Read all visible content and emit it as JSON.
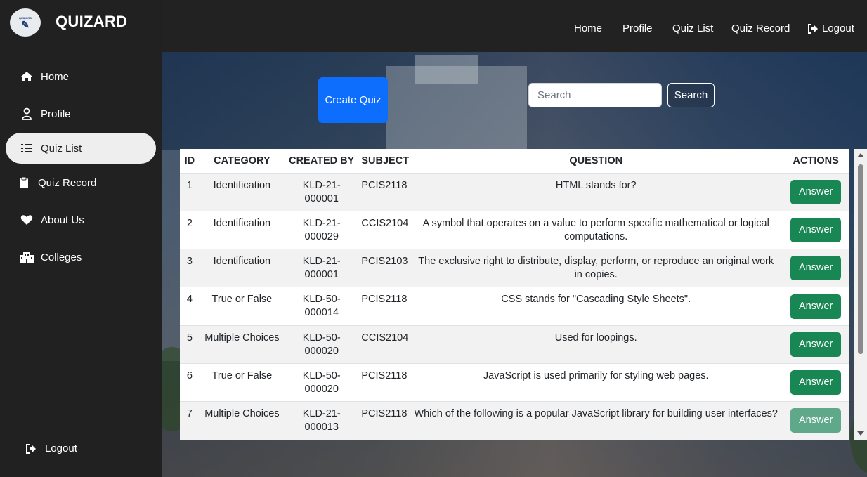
{
  "brand": {
    "name": "QUIZARD",
    "logo_text": "QUIZARD"
  },
  "sidebar": {
    "items": [
      {
        "label": "Home",
        "icon": "home-icon"
      },
      {
        "label": "Profile",
        "icon": "user-icon"
      },
      {
        "label": "Quiz List",
        "icon": "list-icon",
        "active": true
      },
      {
        "label": "Quiz Record",
        "icon": "clipboard-icon"
      },
      {
        "label": "About Us",
        "icon": "heart-icon"
      },
      {
        "label": "Colleges",
        "icon": "building-icon"
      }
    ],
    "logout_label": "Logout"
  },
  "topnav": {
    "links": [
      "Home",
      "Profile",
      "Quiz List",
      "Quiz Record"
    ],
    "logout_label": "Logout"
  },
  "toolbar": {
    "create_label": "Create Quiz",
    "search_placeholder": "Search",
    "search_button": "Search"
  },
  "table": {
    "headers": [
      "ID",
      "CATEGORY",
      "CREATED BY",
      "SUBJECT",
      "QUESTION",
      "ACTIONS"
    ],
    "action_label": "Answer",
    "rows": [
      {
        "id": "1",
        "category": "Identification",
        "created_by": "KLD-21-000001",
        "subject": "PCIS2118",
        "question": "HTML stands for?"
      },
      {
        "id": "2",
        "category": "Identification",
        "created_by": "KLD-21-000029",
        "subject": "CCIS2104",
        "question": "A symbol that operates on a value to perform specific mathematical or logical computations."
      },
      {
        "id": "3",
        "category": "Identification",
        "created_by": "KLD-21-000001",
        "subject": "PCIS2103",
        "question": "The exclusive right to distribute, display, perform, or reproduce an original work in copies."
      },
      {
        "id": "4",
        "category": "True or False",
        "created_by": "KLD-50-000014",
        "subject": "PCIS2118",
        "question": "CSS stands for \"Cascading Style Sheets\"."
      },
      {
        "id": "5",
        "category": "Multiple Choices",
        "created_by": "KLD-50-000020",
        "subject": "CCIS2104",
        "question": "Used for loopings."
      },
      {
        "id": "6",
        "category": "True or False",
        "created_by": "KLD-50-000020",
        "subject": "PCIS2118",
        "question": "JavaScript is used primarily for styling web pages."
      },
      {
        "id": "7",
        "category": "Multiple Choices",
        "created_by": "KLD-21-000013",
        "subject": "PCIS2118",
        "question": "Which of the following is a popular JavaScript library for building user interfaces?"
      }
    ]
  },
  "colors": {
    "primary": "#0d6efd",
    "success": "#198754",
    "sidebar_bg": "#212121",
    "nav_bg": "#222222"
  }
}
